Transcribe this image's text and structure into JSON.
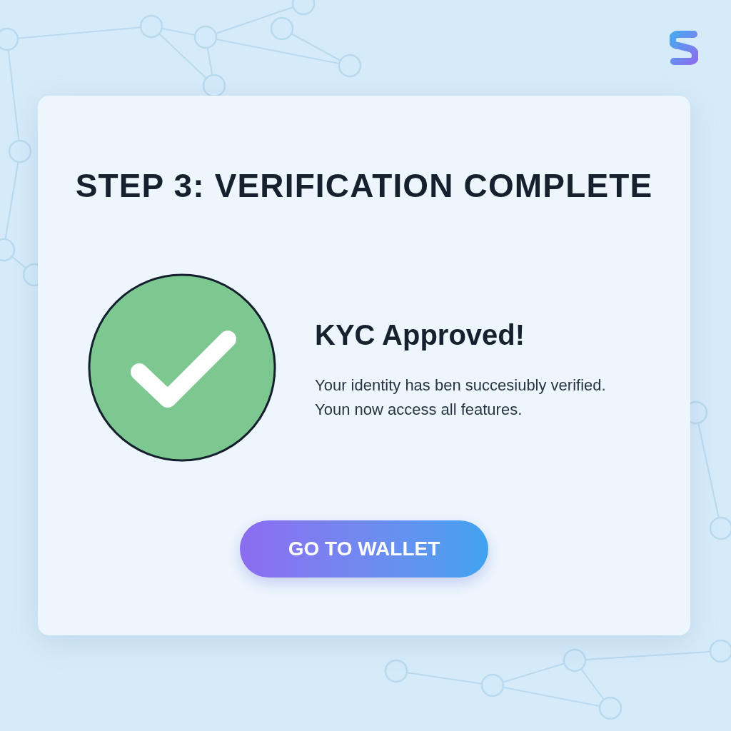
{
  "title": "STEP 3: VERIFICATION COMPLETE",
  "status": {
    "kind": "success",
    "heading": "KYC Approved!",
    "message": "Your identity has ben succesiubly verified. Youn now access all features."
  },
  "button": {
    "label": "GO TO WALLET"
  }
}
